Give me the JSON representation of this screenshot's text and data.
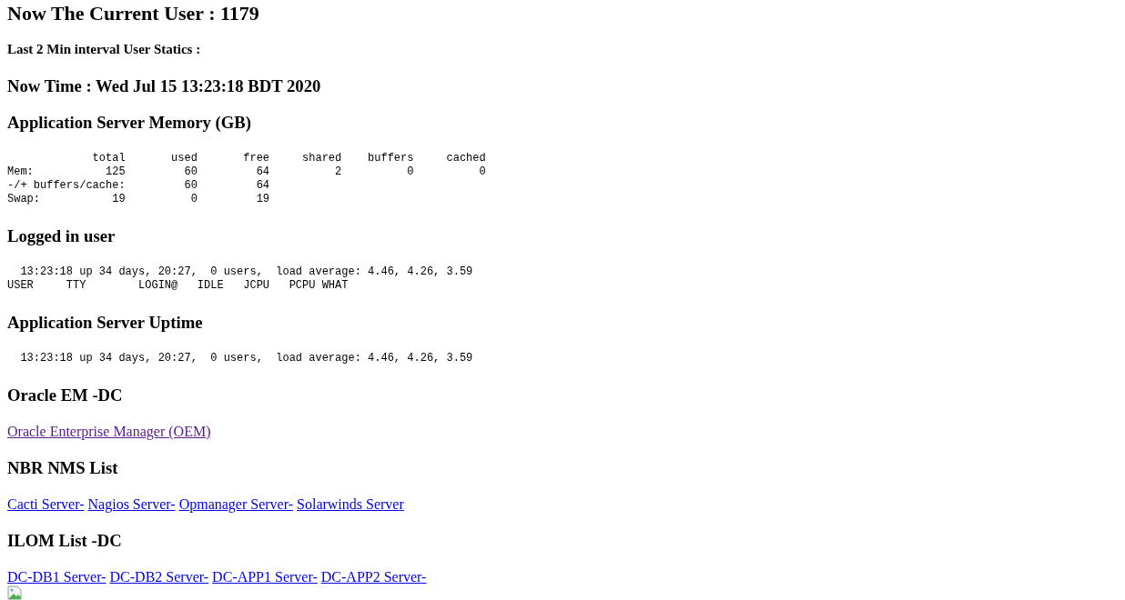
{
  "title": "Now The Current User : 1179",
  "subtitle": "Last 2 Min interval User Statics :",
  "now_time": "Now Time : Wed Jul 15 13:23:18 BDT 2020",
  "sections": [
    {
      "heading": "Application Server Memory (GB)",
      "kind": "pre",
      "lines": [
        "             total       used       free     shared    buffers     cached",
        "Mem:           125         60         64          2          0          0",
        "-/+ buffers/cache:         60         64",
        "Swap:           19          0         19"
      ]
    },
    {
      "heading": "Logged in user",
      "kind": "pre",
      "lines": [
        "  13:23:18 up 34 days, 20:27,  0 users,  load average: 4.46, 4.26, 3.59",
        "USER     TTY        LOGIN@   IDLE   JCPU   PCPU WHAT"
      ]
    },
    {
      "heading": "Application Server Uptime",
      "kind": "pre",
      "lines": [
        "  13:23:18 up 34 days, 20:27,  0 users,  load average: 4.46, 4.26, 3.59"
      ]
    },
    {
      "heading": "Oracle EM -DC",
      "kind": "links",
      "links": [
        {
          "label": "Oracle Enterprise Manager (OEM)",
          "visited": true
        }
      ]
    },
    {
      "heading": "NBR NMS List",
      "kind": "links",
      "links": [
        {
          "label": "Cacti Server-",
          "visited": false
        },
        {
          "label": "Nagios Server-",
          "visited": false
        },
        {
          "label": "Opmanager Server-",
          "visited": false
        },
        {
          "label": "Solarwinds Server",
          "visited": false
        }
      ]
    },
    {
      "heading": "ILOM List -DC",
      "kind": "links",
      "links": [
        {
          "label": "DC-DB1 Server-",
          "visited": false
        },
        {
          "label": "DC-DB2 Server-",
          "visited": false
        },
        {
          "label": "DC-APP1 Server-",
          "visited": false
        },
        {
          "label": "DC-APP2 Server-",
          "visited": false
        }
      ]
    }
  ]
}
